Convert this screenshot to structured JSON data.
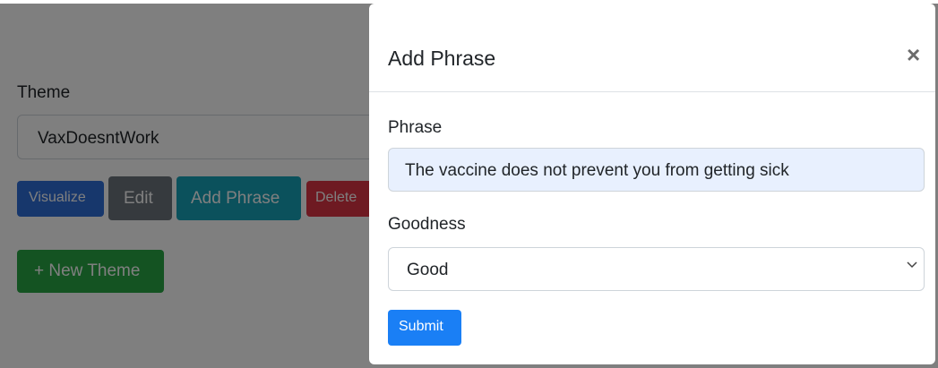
{
  "page": {
    "theme_label": "Theme",
    "theme_value": "VaxDoesntWork",
    "buttons": {
      "visualize": "Visualize",
      "edit": "Edit",
      "add_phrase": "Add Phrase",
      "delete": "Delete",
      "new_theme": "+ New Theme"
    }
  },
  "modal": {
    "title": "Add Phrase",
    "close_glyph": "×",
    "phrase_label": "Phrase",
    "phrase_value": "The vaccine does not prevent you from getting sick",
    "goodness_label": "Goodness",
    "goodness_value": "Good",
    "submit_label": "Submit"
  },
  "colors": {
    "primary": "#1a7ff5",
    "info": "#17a2b8",
    "secondary": "#6c757d",
    "danger": "#dc3545",
    "success": "#28a745",
    "autofill_bg": "#e8f0fe"
  },
  "icons": {
    "close": "close-icon",
    "dropdown": "chevron-down-icon"
  }
}
